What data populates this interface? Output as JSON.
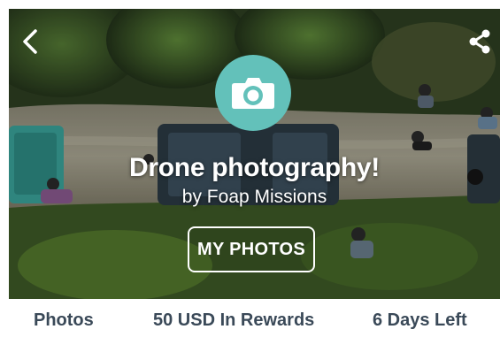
{
  "header": {
    "back_icon": "chevron-left-icon",
    "share_icon": "share-icon"
  },
  "mission": {
    "badge_icon": "camera-icon",
    "badge_color": "#63c1ba",
    "title": "Drone photography!",
    "subtitle": "by Foap Missions",
    "my_photos_label": "MY PHOTOS"
  },
  "stats": {
    "photos_label": "Photos",
    "rewards_label": "50 USD In Rewards",
    "days_left_label": "6 Days Left",
    "text_color": "#3a4958"
  }
}
